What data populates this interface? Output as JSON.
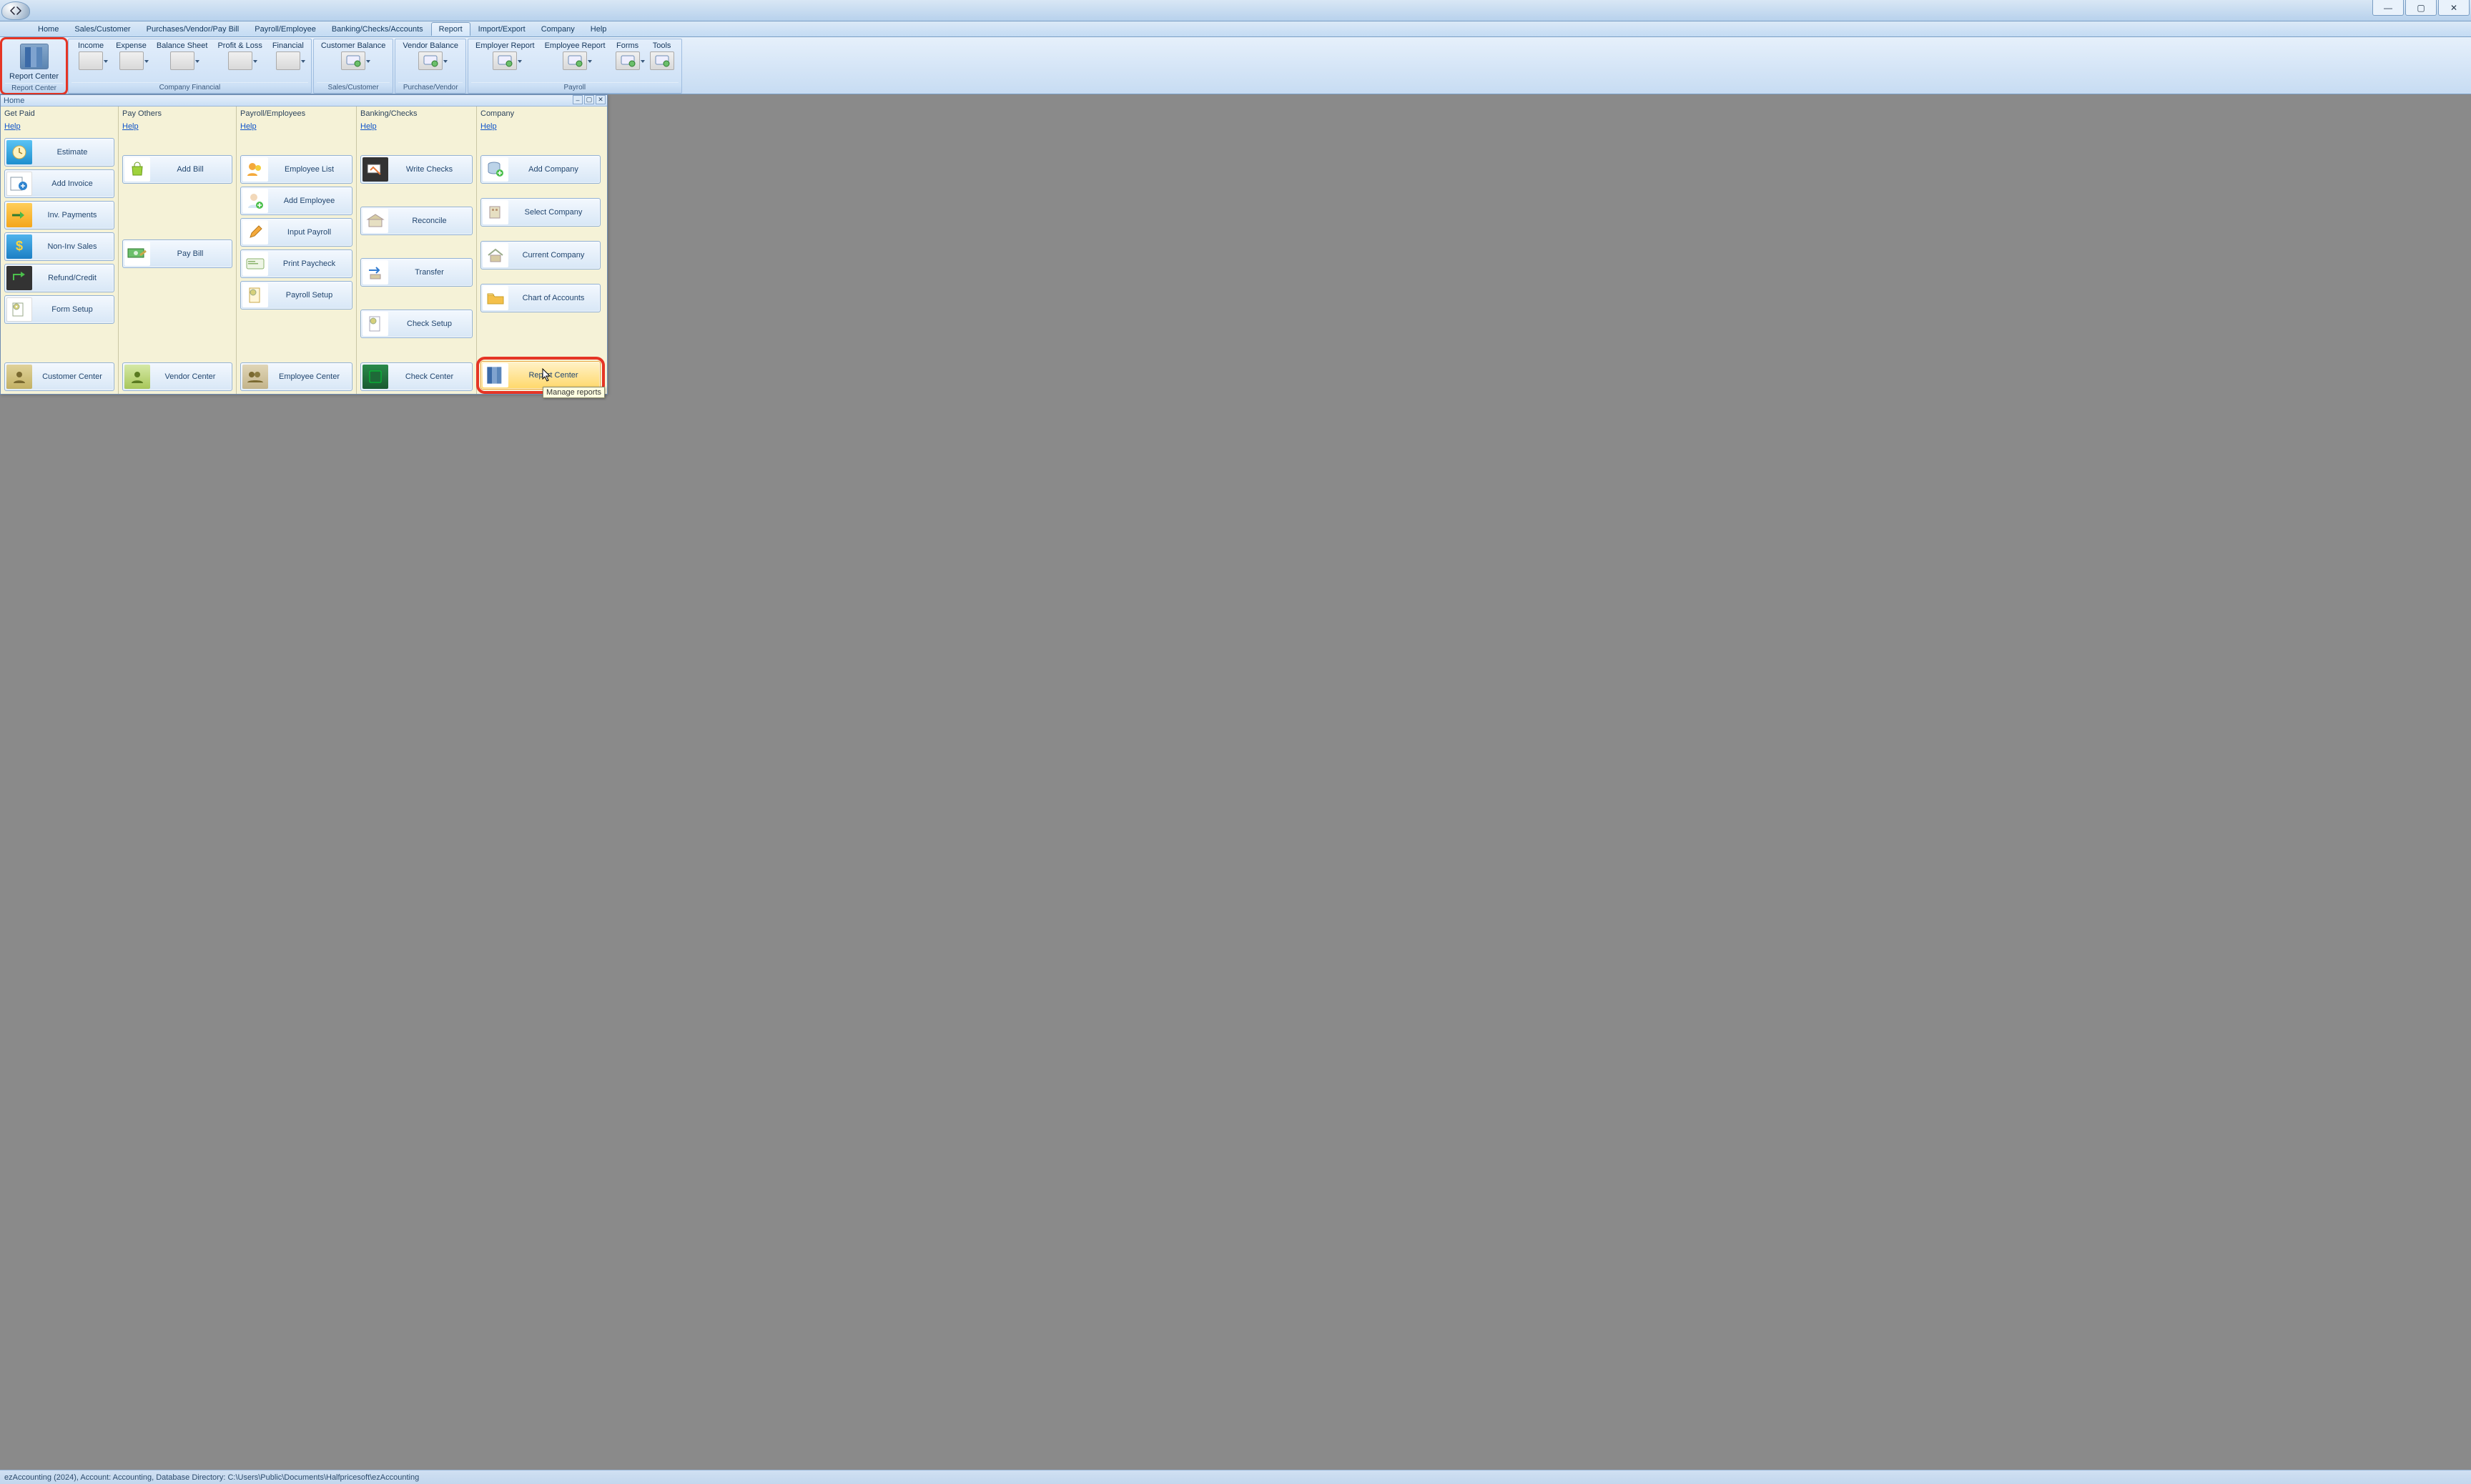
{
  "window_controls": {
    "min": "—",
    "max": "▢",
    "close": "✕"
  },
  "menu": [
    "Home",
    "Sales/Customer",
    "Purchases/Vendor/Pay Bill",
    "Payroll/Employee",
    "Banking/Checks/Accounts",
    "Report",
    "Import/Export",
    "Company",
    "Help"
  ],
  "menu_active_index": 5,
  "ribbon": {
    "report_center": {
      "label1": "Report Center",
      "label2": "Report Center"
    },
    "company_financial": {
      "group_label": "Company Financial",
      "items": [
        "Income",
        "Expense",
        "Balance Sheet",
        "Profit & Loss",
        "Financial"
      ]
    },
    "sales_customer": {
      "group_label": "Sales/Customer",
      "items": [
        "Customer Balance"
      ]
    },
    "purchase_vendor": {
      "group_label": "Purchase/Vendor",
      "items": [
        "Vendor Balance"
      ]
    },
    "payroll": {
      "group_label": "Payroll",
      "items": [
        "Employer Report",
        "Employee Report",
        "Forms",
        "Tools"
      ]
    }
  },
  "home": {
    "title": "Home",
    "get_paid": {
      "heading": "Get Paid",
      "help": "Help",
      "tiles": [
        "Estimate",
        "Add Invoice",
        "Inv. Payments",
        "Non-Inv Sales",
        "Refund/Credit",
        "Form Setup",
        "Customer Center"
      ]
    },
    "pay_others": {
      "heading": "Pay Others",
      "help": "Help",
      "tiles": [
        "Add Bill",
        "Pay Bill",
        "Vendor Center"
      ]
    },
    "payroll_employees": {
      "heading": "Payroll/Employees",
      "help": "Help",
      "tiles": [
        "Employee List",
        "Add Employee",
        "Input Payroll",
        "Print Paycheck",
        "Payroll Setup",
        "Employee Center"
      ]
    },
    "banking_checks": {
      "heading": "Banking/Checks",
      "help": "Help",
      "tiles": [
        "Write Checks",
        "Reconcile",
        "Transfer",
        "Check Setup",
        "Check Center"
      ]
    },
    "company": {
      "heading": "Company",
      "help": "Help",
      "tiles": [
        "Add Company",
        "Select Company",
        "Current Company",
        "Chart of Accounts",
        "Report Center"
      ],
      "tooltip": "Manage reports"
    }
  },
  "status": "ezAccounting (2024), Account: Accounting, Database Directory: C:\\Users\\Public\\Documents\\Halfpricesoft\\ezAccounting"
}
